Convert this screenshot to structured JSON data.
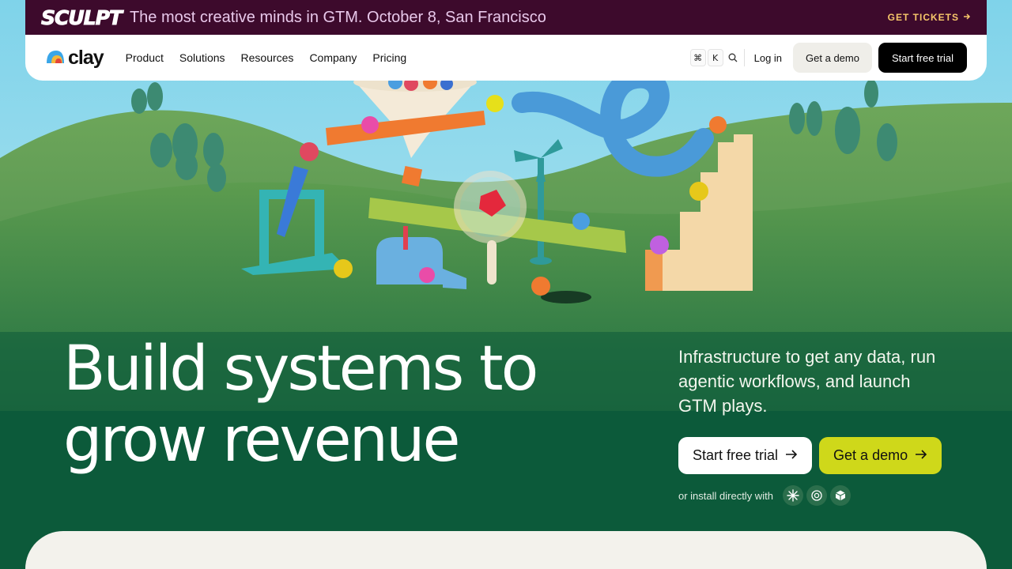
{
  "announcement": {
    "brand": "SCULPT",
    "text": "The most creative minds in GTM. October 8, San Francisco",
    "cta": "GET TICKETS"
  },
  "nav": {
    "logo_text": "clay",
    "menu": [
      "Product",
      "Solutions",
      "Resources",
      "Company",
      "Pricing"
    ],
    "shortcut_keys": [
      "⌘",
      "K"
    ],
    "login": "Log in",
    "demo": "Get a demo",
    "trial": "Start free trial"
  },
  "hero": {
    "headline_line1": "Build systems to",
    "headline_line2": "grow revenue",
    "subcopy": "Infrastructure to get any data, run agentic workflows, and launch GTM plays.",
    "cta_trial": "Start free trial",
    "cta_demo": "Get a demo",
    "install_text": "or install directly with",
    "integrations": [
      "claude-icon",
      "openai-icon",
      "cursor-icon"
    ]
  },
  "colors": {
    "announce_bg": "#3d0a2c",
    "accent_yellow": "#cfd81a",
    "hero_green": "#0c5a3a",
    "panel_bg": "#f3f2ec"
  }
}
